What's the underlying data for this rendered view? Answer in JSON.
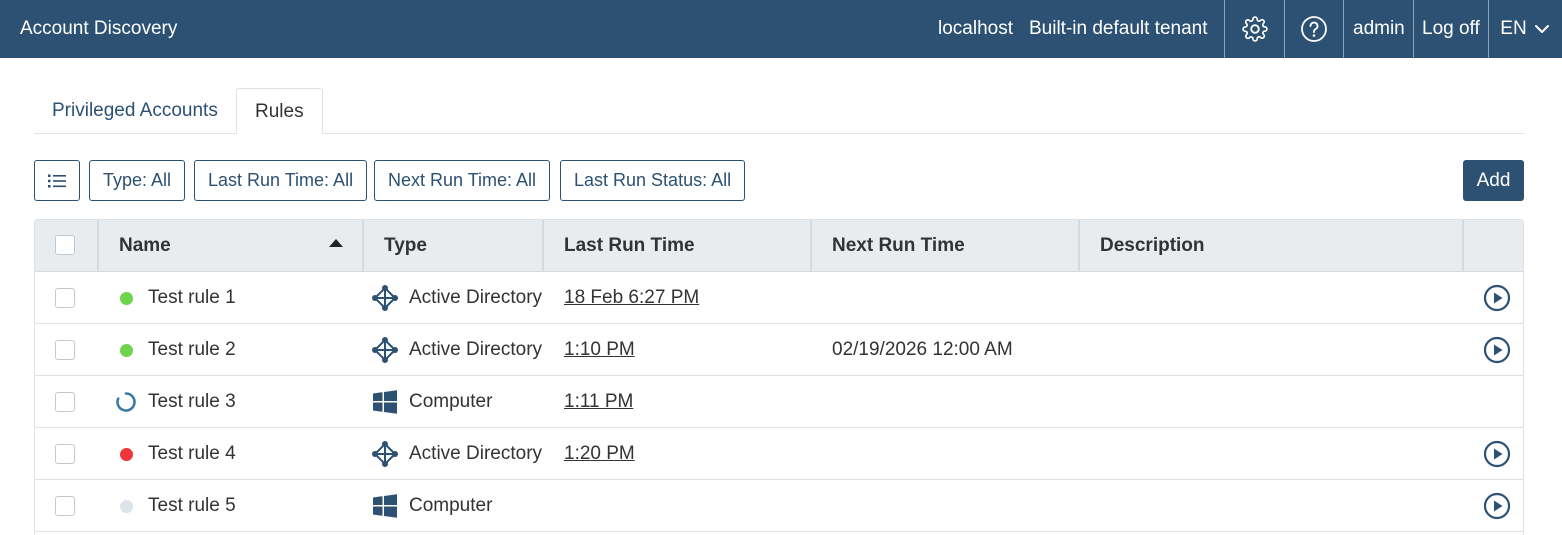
{
  "header": {
    "app_title": "Account Discovery",
    "host": "localhost",
    "tenant": "Built-in default tenant",
    "settings_icon": "gear-icon",
    "help_icon": "help-icon",
    "user": "admin",
    "logoff": "Log off",
    "language": "EN"
  },
  "tabs": [
    {
      "label": "Privileged Accounts",
      "active": false
    },
    {
      "label": "Rules",
      "active": true
    }
  ],
  "toolbar": {
    "list_icon": "list-icon",
    "filters": [
      "Type: All",
      "Last Run Time: All",
      "Next Run Time: All",
      "Last Run Status: All"
    ],
    "add_label": "Add"
  },
  "table": {
    "columns": [
      "Name",
      "Type",
      "Last Run Time",
      "Next Run Time",
      "Description"
    ],
    "sort_column": "Name",
    "sort_direction": "ascending",
    "rows": [
      {
        "name": "Test rule 1",
        "status": "success",
        "status_color": "#6fd34e",
        "type": "Active Directory",
        "type_icon": "active-directory-icon",
        "last_run": "18 Feb 6:27 PM",
        "next_run": "",
        "description": "",
        "can_run": true
      },
      {
        "name": "Test rule 2",
        "status": "success",
        "status_color": "#6fd34e",
        "type": "Active Directory",
        "type_icon": "active-directory-icon",
        "last_run": "1:10 PM",
        "next_run": "02/19/2026 12:00 AM",
        "description": "",
        "can_run": true
      },
      {
        "name": "Test rule 3",
        "status": "running",
        "status_color": "#3e7ba3",
        "type": "Computer",
        "type_icon": "windows-icon",
        "last_run": "1:11 PM",
        "next_run": "",
        "description": "",
        "can_run": false
      },
      {
        "name": "Test rule 4",
        "status": "failed",
        "status_color": "#f0363a",
        "type": "Active Directory",
        "type_icon": "active-directory-icon",
        "last_run": "1:20 PM",
        "next_run": "",
        "description": "",
        "can_run": true
      },
      {
        "name": "Test rule 5",
        "status": "never-run",
        "status_color": "#dde3ea",
        "type": "Computer",
        "type_icon": "windows-icon",
        "last_run": "",
        "next_run": "",
        "description": "",
        "can_run": true
      }
    ]
  }
}
